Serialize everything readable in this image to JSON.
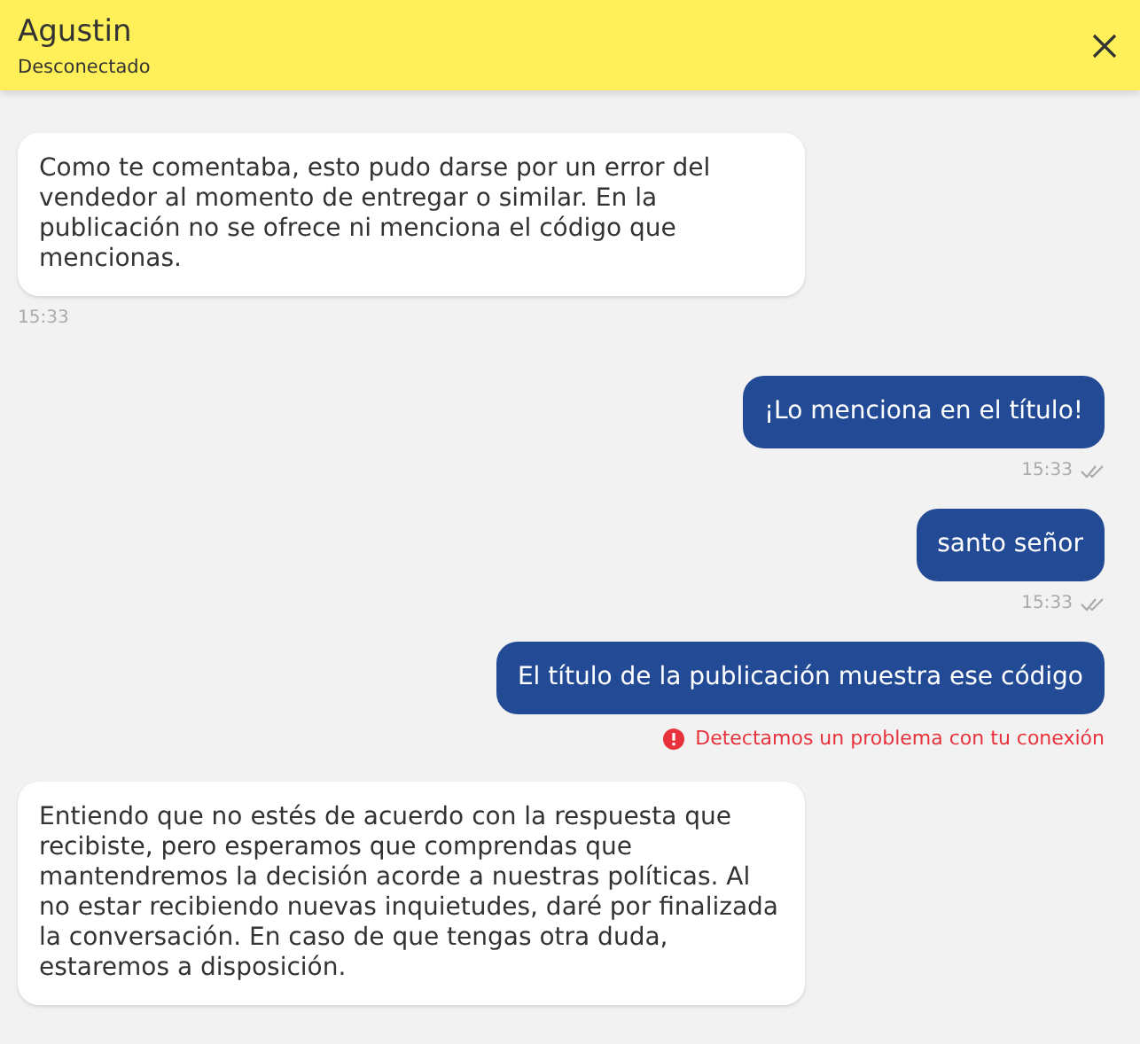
{
  "header": {
    "title": "Agustin",
    "subtitle": "Desconectado"
  },
  "messages": [
    {
      "kind": "incoming",
      "text": "Como te comentaba, esto pudo darse por un error del vendedor al momento de entregar o similar. En la publicación no se ofrece ni menciona el código que mencionas.",
      "time": "15:33"
    },
    {
      "kind": "outgoing",
      "text": "¡Lo menciona en el título!",
      "time": "15:33",
      "read": true,
      "failed": false
    },
    {
      "kind": "outgoing",
      "text": "santo señor",
      "time": "15:33",
      "read": true,
      "failed": false
    },
    {
      "kind": "outgoing",
      "text": "El título de la publicación muestra ese código",
      "read": false,
      "failed": true,
      "error": "Detectamos un problema con tu conexión"
    },
    {
      "kind": "incoming",
      "text": "Entiendo que no estés de acuerdo con la respuesta que recibiste, pero esperamos que comprendas que mantendremos la decisión acorde a nuestras políticas. Al no estar recibiendo nuevas inquietudes, daré por finalizada la conversación. En caso de que tengas otra duda, estaremos a disposición."
    }
  ]
}
